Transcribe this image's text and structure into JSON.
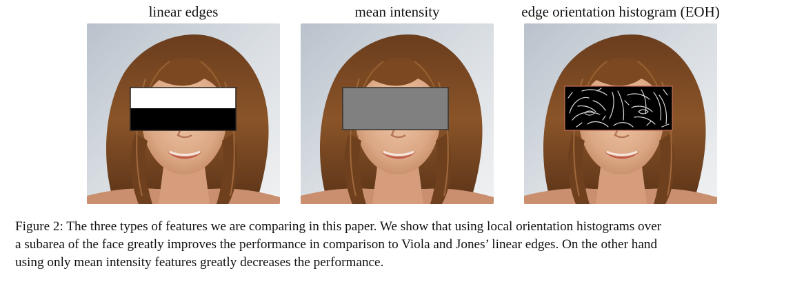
{
  "figure": {
    "panels": [
      {
        "title": "linear edges",
        "feature": "linear-edges"
      },
      {
        "title": "mean intensity",
        "feature": "mean-intensity"
      },
      {
        "title": "edge orientation histogram (EOH)",
        "feature": "edge-orientation-histogram"
      }
    ],
    "caption": {
      "line1": "Figure 2: The three types of features we are comparing in this paper. We show that using local orientation histograms over",
      "line2": "a subarea of the face greatly improves the performance in comparison to Viola and Jones’ linear edges. On the other hand",
      "line3": "using only mean intensity features greatly decreases the performance."
    },
    "colors": {
      "mean_gray": "#808080",
      "edge_white": "#ffffff",
      "edge_black": "#000000"
    }
  }
}
